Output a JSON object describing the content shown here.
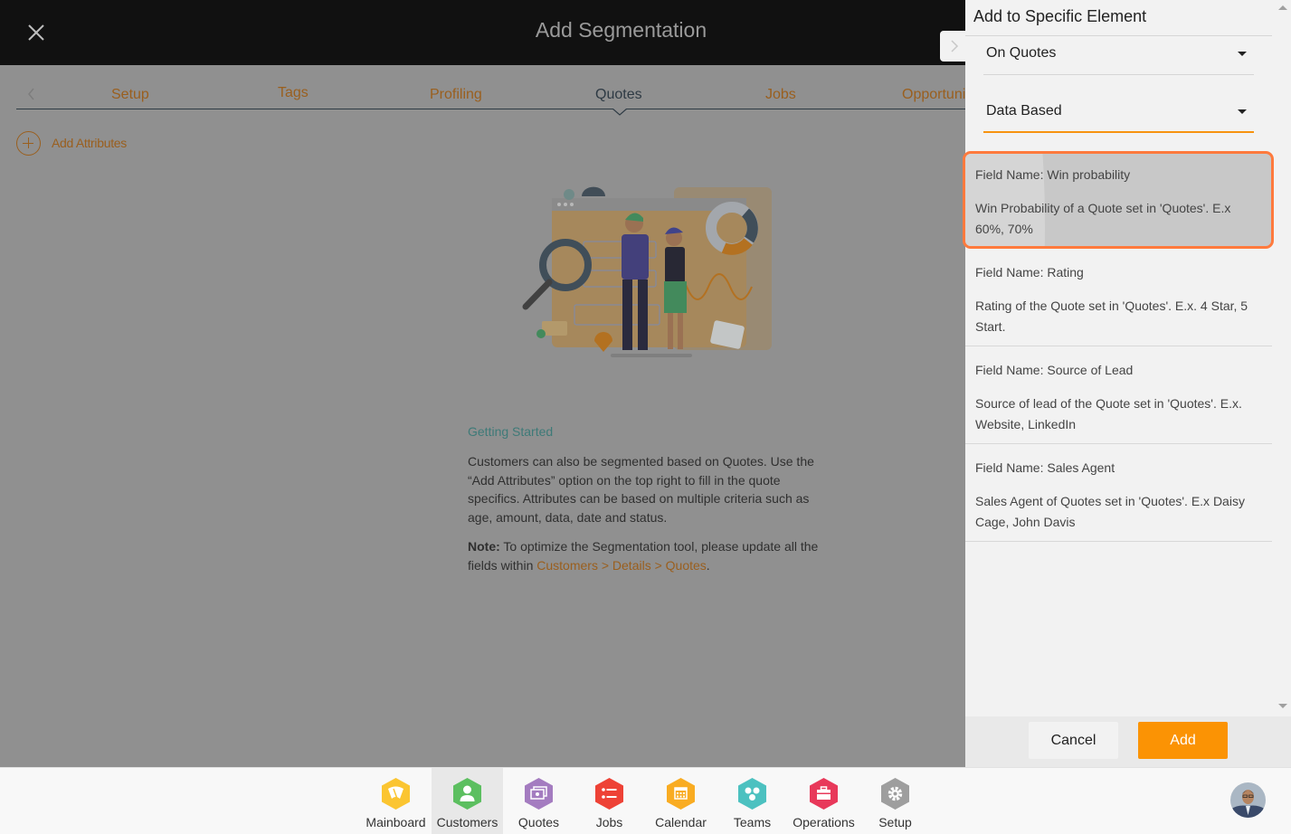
{
  "header": {
    "title": "Add Segmentation",
    "close_icon": "close-icon",
    "panel_toggle_icon": "chevron-right-icon"
  },
  "tabs": [
    {
      "label": "Setup",
      "active": false
    },
    {
      "label": "Tags",
      "active": false
    },
    {
      "label": "Profiling",
      "active": false
    },
    {
      "label": "Quotes",
      "active": true
    },
    {
      "label": "Jobs",
      "active": false
    },
    {
      "label": "Opportuni",
      "active": false
    }
  ],
  "add_attributes": {
    "label": "Add Attributes",
    "icon": "plus-circle-icon"
  },
  "info": {
    "heading": "Getting Started",
    "body": "Customers can also be segmented based on Quotes. Use the “Add Attributes” option on the top right to fill in the quote specifics. Attributes can be based on multiple criteria such as age, amount, data, date and status.",
    "note_label": "Note:",
    "note_text": " To optimize the Segmentation tool, please update all the fields within ",
    "note_link": "Customers > Details > Quotes",
    "note_end": "."
  },
  "panel": {
    "title": "Add to Specific Element",
    "select_element": {
      "value": "On Quotes"
    },
    "select_type": {
      "value": "Data Based"
    },
    "fields": [
      {
        "name": "Field Name: Win probability",
        "description": "Win Probability of a Quote set in 'Quotes'. E.x 60%, 70%",
        "selected": true
      },
      {
        "name": "Field Name: Rating",
        "description": "Rating of the Quote set in 'Quotes'. E.x. 4 Star, 5 Start.",
        "selected": false
      },
      {
        "name": "Field Name: Source of Lead",
        "description": "Source of lead of the Quote set in 'Quotes'. E.x. Website, LinkedIn",
        "selected": false
      },
      {
        "name": "Field Name: Sales Agent",
        "description": "Sales Agent of Quotes set in 'Quotes'. E.x Daisy Cage, John Davis",
        "selected": false
      }
    ],
    "cancel_label": "Cancel",
    "add_label": "Add"
  },
  "bottom_nav": [
    {
      "label": "Mainboard",
      "icon": "mainboard-icon",
      "color": "#fbc531",
      "active": false
    },
    {
      "label": "Customers",
      "icon": "user-icon",
      "color": "#5cbf60",
      "active": true
    },
    {
      "label": "Quotes",
      "icon": "money-icon",
      "color": "#a47cc0",
      "active": false
    },
    {
      "label": "Jobs",
      "icon": "list-icon",
      "color": "#ee4236",
      "active": false
    },
    {
      "label": "Calendar",
      "icon": "calendar-icon",
      "color": "#f9ac22",
      "active": false
    },
    {
      "label": "Teams",
      "icon": "team-icon",
      "color": "#4cc1c0",
      "active": false
    },
    {
      "label": "Operations",
      "icon": "briefcase-icon",
      "color": "#e8385a",
      "active": false
    },
    {
      "label": "Setup",
      "icon": "gear-icon",
      "color": "#9e9e9e",
      "active": false
    }
  ],
  "colors": {
    "accent": "#fb9304",
    "selection_border": "#ff7a3d",
    "tab_link": "#9a5f1e",
    "heading_teal": "#3e7a78"
  }
}
